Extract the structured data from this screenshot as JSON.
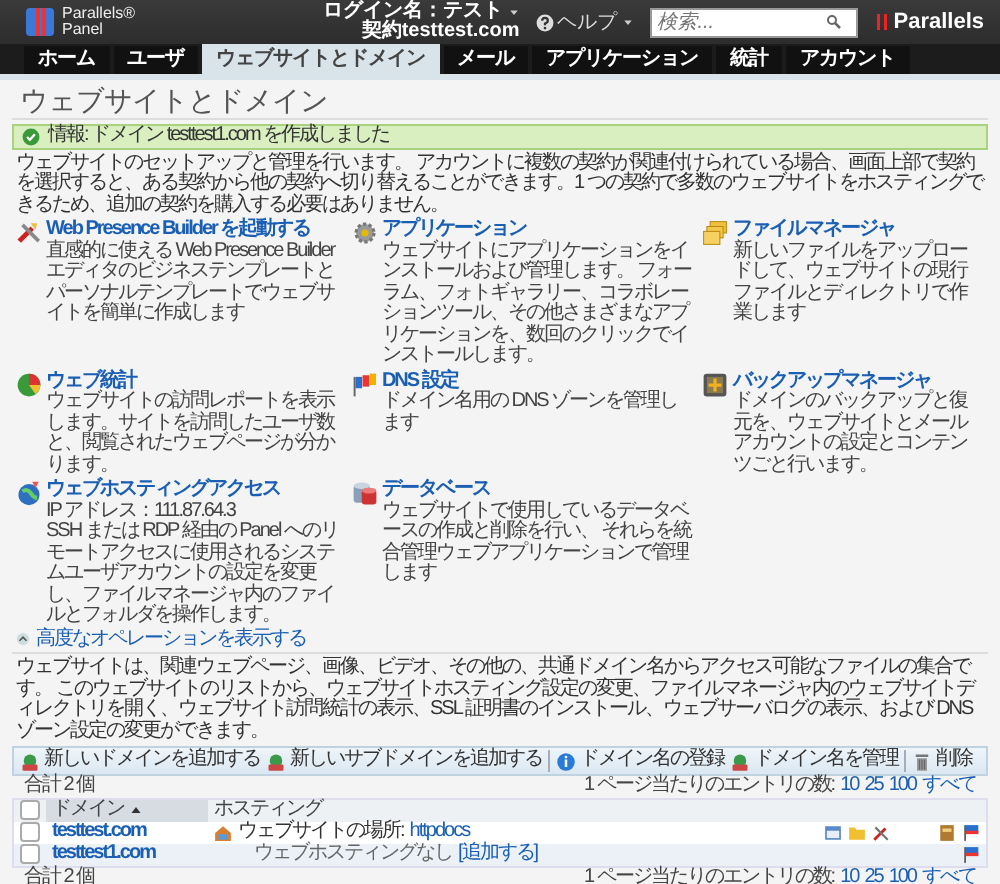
{
  "header": {
    "logo_top": "Parallels®",
    "logo_bottom": "Panel",
    "login": "ログイン名：テスト",
    "subscription": "契約testtest.com",
    "help": "ヘルプ",
    "search": {
      "placeholder": "検索..."
    },
    "brand": "Parallels"
  },
  "tabs": [
    {
      "label": "ホーム",
      "selected": false
    },
    {
      "label": "ユーザ",
      "selected": false
    },
    {
      "label": "ウェブサイトとドメイン",
      "selected": true
    },
    {
      "label": "メール",
      "selected": false
    },
    {
      "label": "アプリケーション",
      "selected": false
    },
    {
      "label": "統計",
      "selected": false
    },
    {
      "label": "アカウント",
      "selected": false
    }
  ],
  "page_title": "ウェブサイトとドメイン",
  "message": {
    "label": "情報:",
    "text": "ドメイン testtest1.com を作成しました"
  },
  "intro": "ウェブサイトのセットアップと管理を行います。 アカウントに複数の契約が関連付けられている場合、画面上部で契約を選択すると、ある契約から他の契約へ切り替えることができます。1 つの契約で多数のウェブサイトをホスティングできるため、追加の契約を購入する必要はありません。",
  "tools": [
    {
      "kind": "builder",
      "title": "Web Presence Builder を起動する",
      "lines": [
        "直感的に使える Web Presence Builder エディタのビジネステンプレートとパーソナルテンプレートでウェブサイトを簡単に作成します"
      ]
    },
    {
      "kind": "apps",
      "title": "アプリケーション",
      "lines": [
        "ウェブサイトにアプリケーションをインストールおよび管理します。 フォーラム、フォトギャラリー、コラボレーションツール、その他さまざまなアプリケーションを、数回のクリックでインストールします。"
      ]
    },
    {
      "kind": "files",
      "title": "ファイルマネージャ",
      "lines": [
        "新しいファイルをアップロードして、ウェブサイトの現行ファイルとディレクトリで作業します"
      ]
    },
    {
      "kind": "stats",
      "title": "ウェブ統計",
      "lines": [
        "ウェブサイトの訪問レポートを表示します。サイトを訪問したユーザ数と、閲覧されたウェブページが分かります。"
      ]
    },
    {
      "kind": "dns",
      "title": "DNS 設定",
      "lines": [
        "ドメイン名用の DNS ゾーンを管理します"
      ]
    },
    {
      "kind": "backup",
      "title": "バックアップマネージャ",
      "lines": [
        "ドメインのバックアップと復元を、ウェブサイトとメールアカウントの設定とコンテンツごと行います。"
      ]
    },
    {
      "kind": "hosting",
      "title": "ウェブホスティングアクセス",
      "lines": [
        "IP アドレス：111.87.64.3",
        "SSH または RDP 経由の Panel へのリモートアクセスに使用されるシステムユーザアカウントの設定を変更し、ファイルマネージャ内のファイルとフォルダを操作します。"
      ]
    },
    {
      "kind": "database",
      "title": "データベース",
      "lines": [
        "ウェブサイトで使用しているデータベースの作成と削除を行い、 それらを統合管理ウェブアプリケーションで管理します"
      ]
    }
  ],
  "advanced_link": "高度なオペレーションを表示する",
  "description": "ウェブサイトは、関連ウェブページ、画像、ビデオ、その他の、共通ドメイン名からアクセス可能なファイルの集合です。 このウェブサイトのリストから、ウェブサイトホスティング設定の変更、ファイルマネージャ内のウェブサイトディレクトリを開く、ウェブサイト訪問統計の表示、SSL 証明書のインストール、ウェブサーバログの表示、および DNS ゾーン設定の変更ができます。",
  "toolbar": [
    [
      {
        "kind": "add",
        "label": "新しいドメインを追加する"
      },
      {
        "kind": "add",
        "label": "新しいサブドメインを追加する"
      }
    ],
    [
      {
        "kind": "register",
        "label": "ドメイン名の登録"
      },
      {
        "kind": "add",
        "label": "ドメイン名を管理"
      }
    ],
    [
      {
        "kind": "delete",
        "label": "削除"
      }
    ]
  ],
  "pager_top": {
    "total": "合計 2 個",
    "label": "1 ページ当たりのエントリの数:",
    "options": [
      "10",
      "25",
      "100",
      "すべて"
    ]
  },
  "table": {
    "select_all": {
      "checked": false
    },
    "columns": [
      {
        "label": "ドメイン",
        "sorted": true
      },
      {
        "label": "ホスティング",
        "sorted": false
      }
    ],
    "rows": [
      {
        "checked": false,
        "domain": "testtest.com",
        "hosting": {
          "kind": "site",
          "label": "ウェブサイトの場所:",
          "link": "httpdocs"
        },
        "actions": [
          {
            "kind": "window"
          },
          {
            "kind": "folder"
          },
          {
            "kind": "tools"
          },
          {
            "kind": "gap"
          },
          {
            "kind": "backup"
          },
          {
            "kind": "flag"
          }
        ]
      },
      {
        "checked": false,
        "domain": "testtest1.com",
        "hosting": {
          "kind": "none",
          "label": "ウェブホスティングなし",
          "link": "[追加する]"
        },
        "actions": [
          {
            "kind": "flag"
          }
        ]
      }
    ]
  },
  "pager_bottom": {
    "total": "合計 2 個",
    "label": "1 ページ当たりのエントリの数:",
    "options": [
      "10",
      "25",
      "100",
      "すべて"
    ]
  }
}
